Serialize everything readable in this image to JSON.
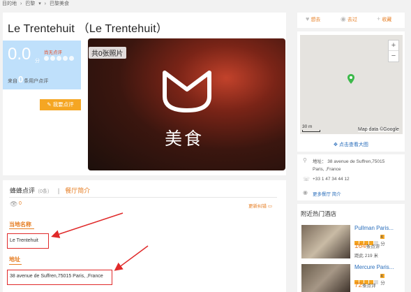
{
  "breadcrumb": {
    "home": "目的地",
    "city": "巴黎",
    "current": "巴黎美食"
  },
  "restaurant": {
    "name": "Le Trentehuit （Le Trentehuit）"
  },
  "rating": {
    "score": "0.0",
    "unit": "分",
    "no_review": "尚无点评",
    "from_prefix": "来自",
    "user_count": "0",
    "from_suffix": "条用户点评",
    "star_count": 5
  },
  "review_button": "我要点评",
  "photo": {
    "badge": "共0张照片",
    "caption": "美食"
  },
  "tabs": {
    "reviews": "蜂蜂点评",
    "reviews_count": "（0条）",
    "intro": "餐厅简介"
  },
  "stats": {
    "views": "0",
    "update_label": "更新纠错"
  },
  "details": {
    "local_name_label": "当地名称",
    "local_name": "Le Trentehuit",
    "address_label": "地址",
    "address": "38 avenue de Suffren,75015 Paris, ,France"
  },
  "actions": {
    "want": "想去",
    "been": "去过",
    "favorite": "收藏"
  },
  "map": {
    "zoom_in": "+",
    "zoom_out": "−",
    "scale": "30 m",
    "attribution": "Map data ©Google",
    "view_large": "点击查看大图"
  },
  "info": {
    "address_line1": "地址： 38 avenue de Suffren,75015",
    "address_line2": "Paris, ,France",
    "phone": "+33 1 47 34 44 12",
    "more": "更多餐厅 简介"
  },
  "hotels": {
    "title": "附近热门酒店",
    "items": [
      {
        "name": "Pullman Paris...",
        "score": "4分",
        "count": "164",
        "count_unit": "条点评",
        "distance": "距此 219 米",
        "stars": 4
      },
      {
        "name": "Mercure Paris...",
        "score": "4分",
        "count": "72",
        "count_unit": "条点评",
        "distance": "",
        "stars": 4
      }
    ]
  }
}
